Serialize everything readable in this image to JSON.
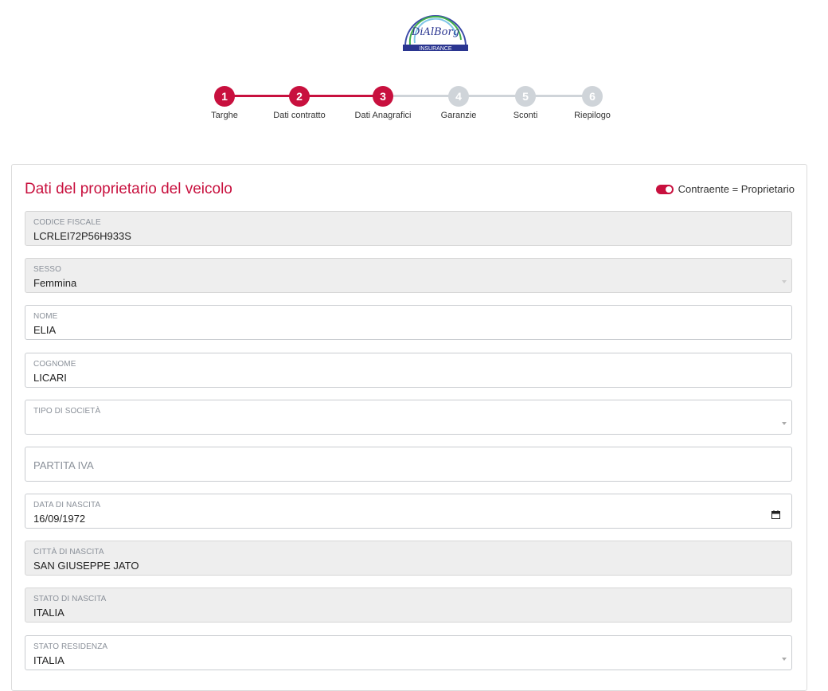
{
  "logo": {
    "brand": "DiAlBorg",
    "sub": "INSURANCE"
  },
  "colors": {
    "accent": "#c8103e",
    "inactive": "#cfd4d9"
  },
  "steps": [
    {
      "num": "1",
      "label": "Targhe",
      "state": "done"
    },
    {
      "num": "2",
      "label": "Dati contratto",
      "state": "done"
    },
    {
      "num": "3",
      "label": "Dati Anagrafici",
      "state": "active"
    },
    {
      "num": "4",
      "label": "Garanzie",
      "state": "pending"
    },
    {
      "num": "5",
      "label": "Sconti",
      "state": "pending"
    },
    {
      "num": "6",
      "label": "Riepilogo",
      "state": "pending"
    }
  ],
  "section": {
    "title": "Dati del proprietario del veicolo",
    "toggle_label": "Contraente = Proprietario",
    "toggle_on": true
  },
  "fields": {
    "codice_fiscale": {
      "label": "CODICE FISCALE",
      "value": "LCRLEI72P56H933S"
    },
    "sesso": {
      "label": "SESSO",
      "value": "Femmina"
    },
    "nome": {
      "label": "NOME",
      "value": "ELIA"
    },
    "cognome": {
      "label": "COGNOME",
      "value": "LICARI"
    },
    "tipo_societa": {
      "label": "TIPO DI SOCIETÀ",
      "value": ""
    },
    "partita_iva": {
      "placeholder": "PARTITA IVA"
    },
    "data_nascita": {
      "label": "DATA DI NASCITA",
      "value": "16/09/1972"
    },
    "citta_nascita": {
      "label": "CITTÀ DI NASCITA",
      "value": "SAN GIUSEPPE JATO"
    },
    "stato_nascita": {
      "label": "STATO DI NASCITA",
      "value": "ITALIA"
    },
    "stato_residenza": {
      "label": "STATO RESIDENZA",
      "value": "ITALIA"
    }
  }
}
